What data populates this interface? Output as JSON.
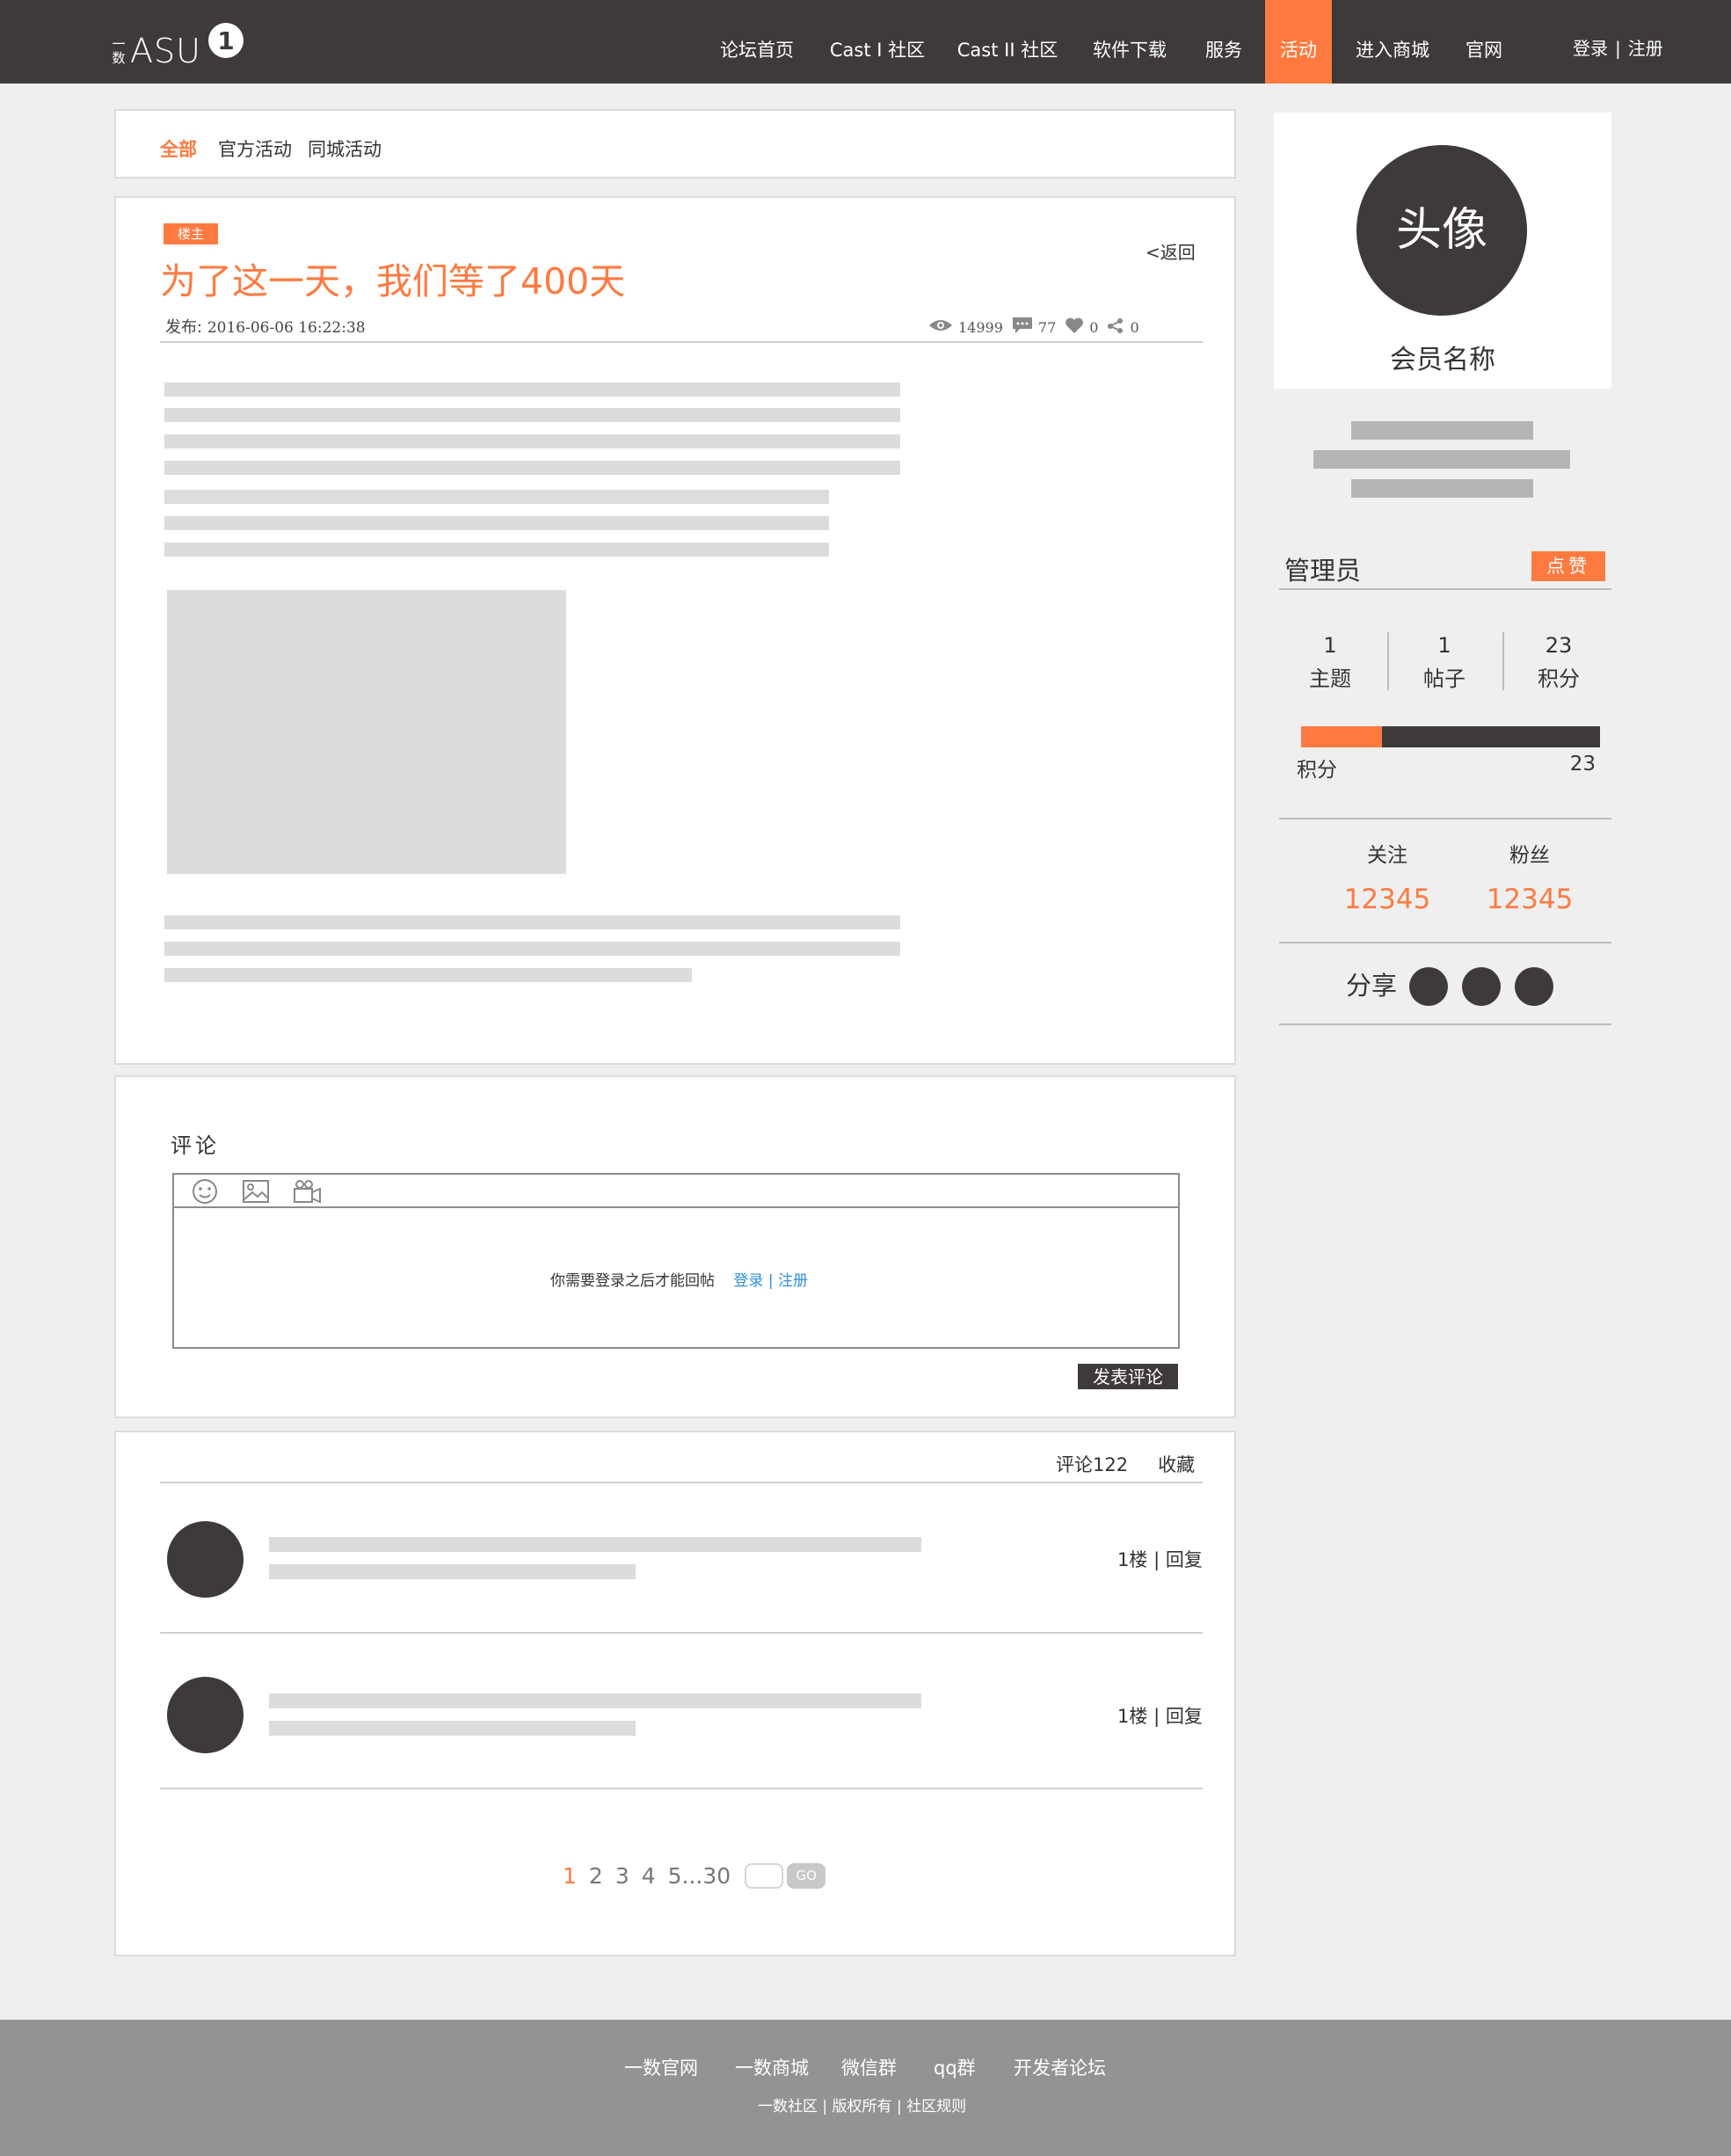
{
  "header": {
    "logo_small": "一数",
    "logo_word": "ASU",
    "logo_badge": "1",
    "nav": [
      {
        "label": "论坛首页"
      },
      {
        "label": "Cast I 社区"
      },
      {
        "label": "Cast II 社区"
      },
      {
        "label": "软件下载"
      },
      {
        "label": "服务"
      },
      {
        "label": "活动"
      },
      {
        "label": "进入商城"
      },
      {
        "label": "官网"
      }
    ],
    "active_nav": "活动",
    "login": "登录",
    "separator": "|",
    "register": "注册"
  },
  "filters": [
    "全部",
    "官方活动",
    "同城活动"
  ],
  "active_filter": "全部",
  "post": {
    "badge": "楼主",
    "title": "为了这一天，我们等了400天",
    "back": "<返回",
    "date_label": "发布:",
    "date": "2016-06-06 16:22:38",
    "views": "14999",
    "comments": "77",
    "likes": "0",
    "shares": "0"
  },
  "comment_form": {
    "label": "评论",
    "prompt": "你需要登录之后才能回帖",
    "login_link": "登录",
    "separator": "|",
    "register_link": "注册",
    "submit": "发表评论"
  },
  "comment_list": {
    "count_label": "评论122",
    "favorite": "收藏",
    "items": [
      {
        "floor": "1楼",
        "separator": "|",
        "reply": "回复"
      },
      {
        "floor": "1楼",
        "separator": "|",
        "reply": "回复"
      }
    ]
  },
  "pagination": {
    "pages": [
      "1",
      "2",
      "3",
      "4",
      "5...30"
    ],
    "current": "1",
    "go": "GO"
  },
  "profile": {
    "avatar_text": "头像",
    "member_name": "会员名称",
    "role": "管理员",
    "like_button": "点赞",
    "stats": [
      {
        "value": "1",
        "label": "主题"
      },
      {
        "value": "1",
        "label": "帖子"
      },
      {
        "value": "23",
        "label": "积分"
      }
    ],
    "points_label": "积分",
    "points_value": "23",
    "points_progress": 0.27,
    "following_label": "关注",
    "following": "12345",
    "followers_label": "粉丝",
    "followers": "12345",
    "share_label": "分享"
  },
  "footer": {
    "links": [
      "一数官网",
      "一数商城",
      "微信群",
      "qq群",
      "开发者论坛"
    ],
    "bottom": "一数社区 | 版权所有 | 社区规则"
  },
  "colors": {
    "accent": "#ff7a40",
    "dark": "#3e3a39",
    "link": "#2e8ee0",
    "footer": "#939393"
  }
}
